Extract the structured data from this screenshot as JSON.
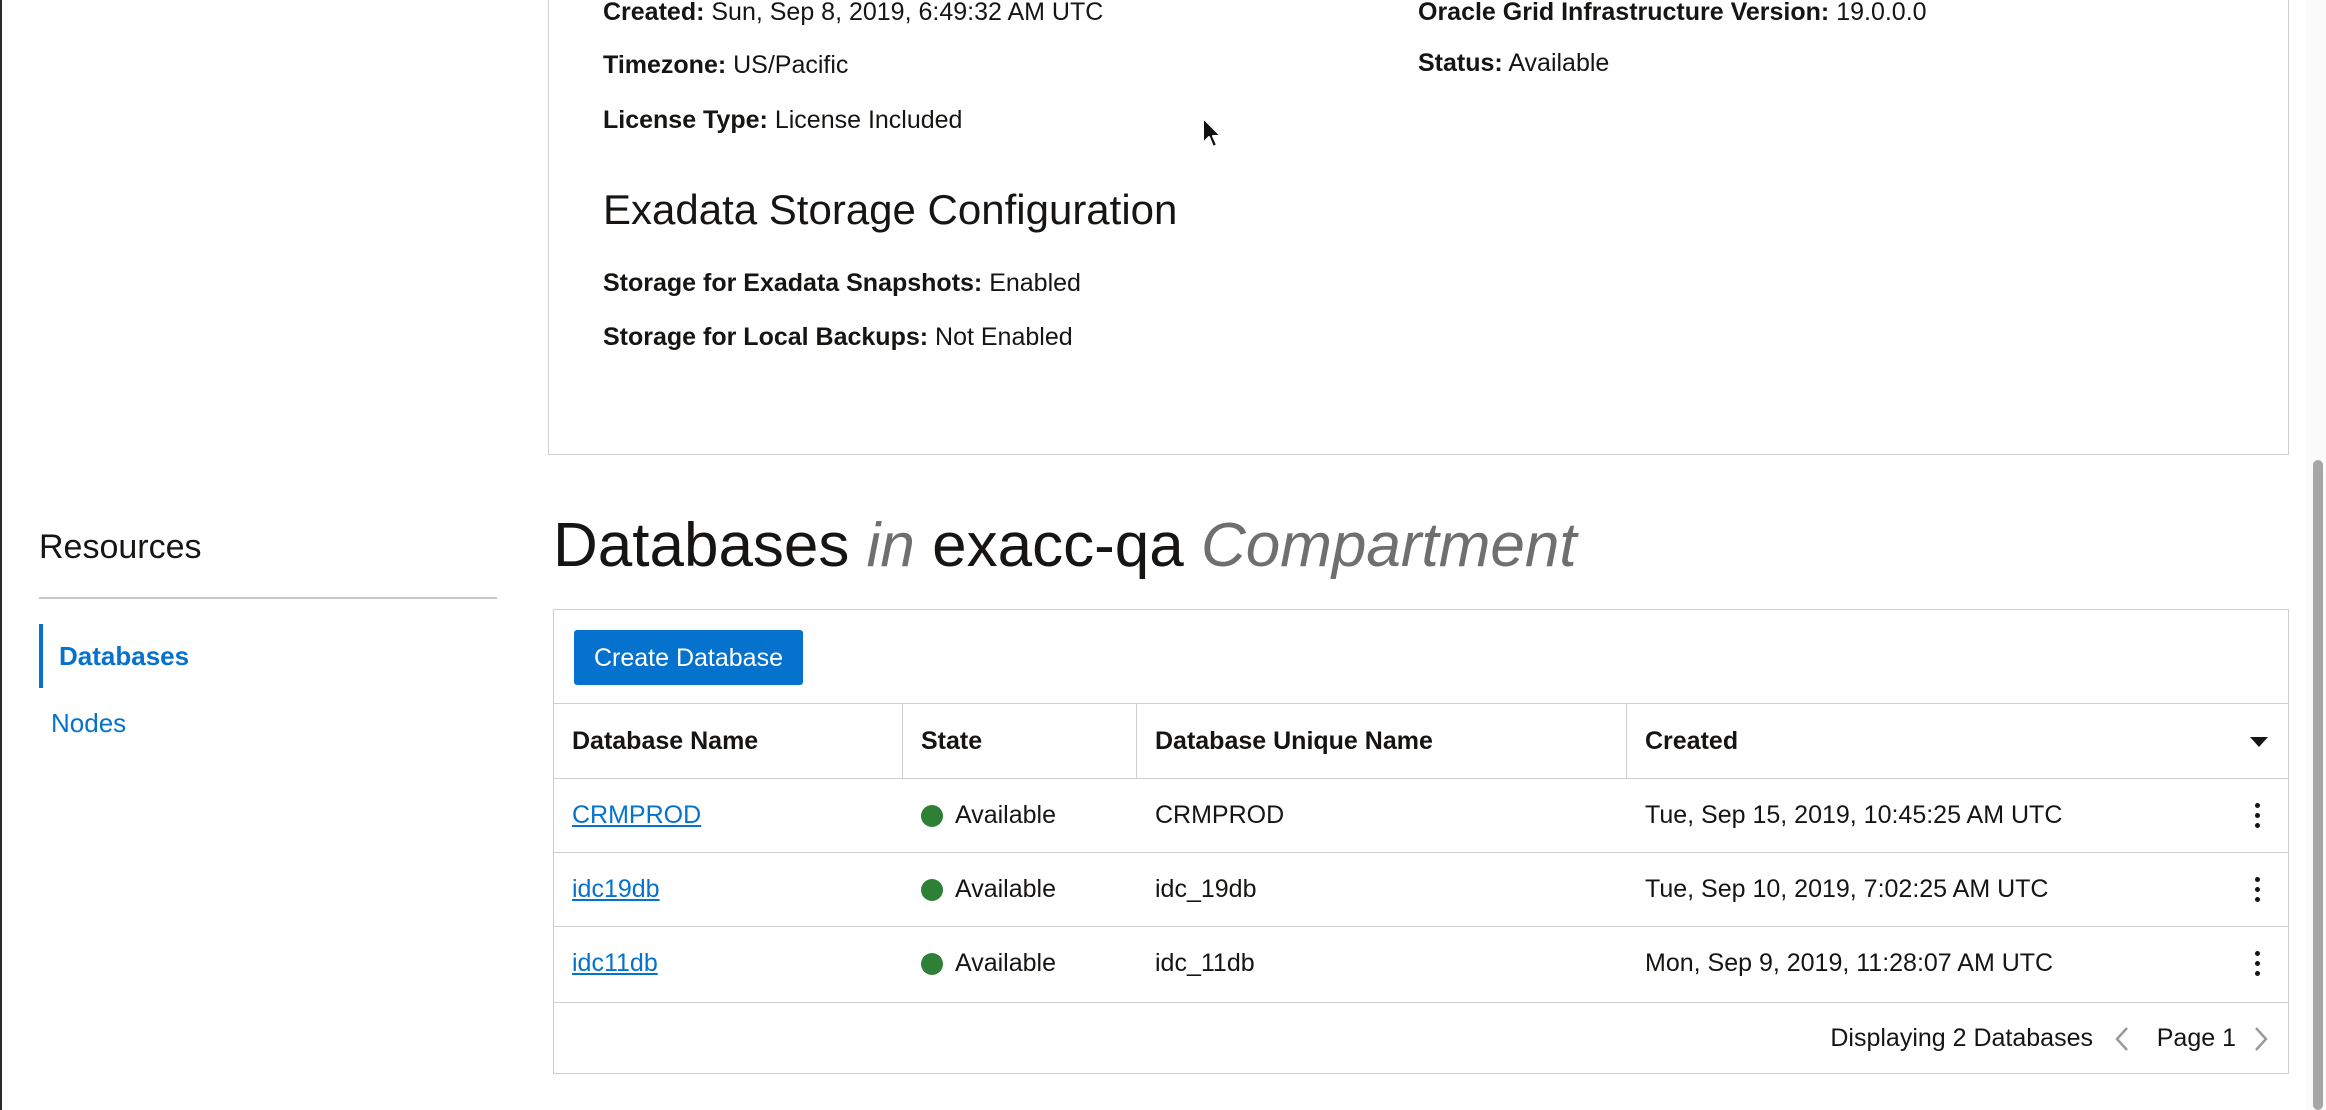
{
  "details": {
    "created_label": "Created:",
    "created_value": "Sun, Sep 8, 2019, 6:49:32 AM UTC",
    "timezone_label": "Timezone:",
    "timezone_value": "US/Pacific",
    "license_label": "License Type:",
    "license_value": "License Included",
    "grid_version_label": "Oracle Grid Infrastructure Version:",
    "grid_version_value": "19.0.0.0",
    "status_label": "Status:",
    "status_value": "Available"
  },
  "storage": {
    "title": "Exadata Storage Configuration",
    "snapshots_label": "Storage for Exadata Snapshots:",
    "snapshots_value": "Enabled",
    "backups_label": "Storage for Local Backups:",
    "backups_value": "Not Enabled"
  },
  "resources": {
    "title": "Resources",
    "items": [
      {
        "label": "Databases",
        "active": true
      },
      {
        "label": "Nodes",
        "active": false
      }
    ]
  },
  "heading": {
    "part1": "Databases",
    "part2": "in",
    "part3": "exacc-qa",
    "part4": "Compartment"
  },
  "table": {
    "create_button": "Create Database",
    "columns": [
      "Database Name",
      "State",
      "Database Unique Name",
      "Created"
    ],
    "rows": [
      {
        "name": "CRMPROD",
        "state": "Available",
        "unique_name": "CRMPROD",
        "created": "Tue, Sep 15, 2019, 10:45:25 AM UTC"
      },
      {
        "name": "idc19db",
        "state": "Available",
        "unique_name": "idc_19db",
        "created": "Tue, Sep 10, 2019, 7:02:25 AM UTC"
      },
      {
        "name": "idc11db",
        "state": "Available",
        "unique_name": "idc_11db",
        "created": "Mon, Sep 9, 2019, 11:28:07 AM UTC"
      }
    ],
    "footer_text": "Displaying 2 Databases",
    "page_label": "Page 1"
  },
  "colors": {
    "link": "#0572ce",
    "button_bg": "#0572ce",
    "status_available": "#2d8036"
  }
}
